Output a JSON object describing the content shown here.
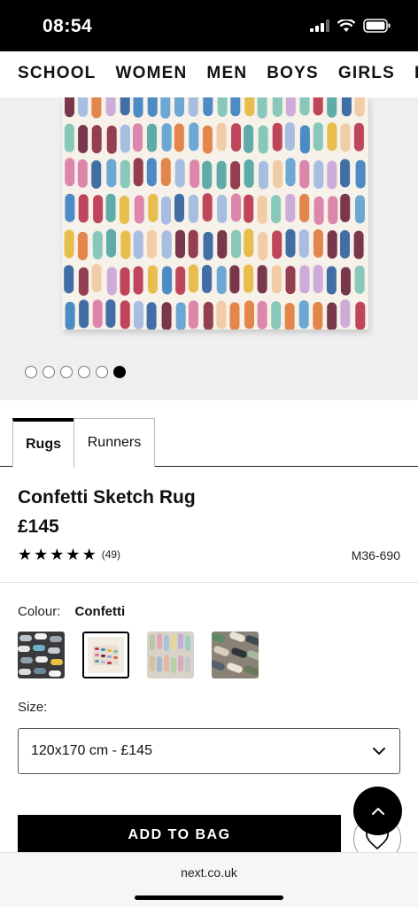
{
  "status_bar": {
    "time": "08:54"
  },
  "nav": {
    "items": [
      "SCHOOL",
      "WOMEN",
      "MEN",
      "BOYS",
      "GIRLS",
      "HOM"
    ]
  },
  "gallery": {
    "image_count": 6,
    "active_index": 5
  },
  "tabs": [
    {
      "label": "Rugs",
      "active": true
    },
    {
      "label": "Runners",
      "active": false
    }
  ],
  "product": {
    "title": "Confetti Sketch Rug",
    "price": "£145",
    "rating_stars": 5,
    "review_count": "(49)",
    "code": "M36-690"
  },
  "colour": {
    "label": "Colour:",
    "selected": "Confetti",
    "swatches": [
      "grey-pattern",
      "confetti",
      "pastel-stripe",
      "neutral-pattern"
    ]
  },
  "size": {
    "label": "Size:",
    "selected": "120x170 cm - £145"
  },
  "actions": {
    "add_to_bag": "ADD TO BAG"
  },
  "browser": {
    "url": "next.co.uk"
  }
}
